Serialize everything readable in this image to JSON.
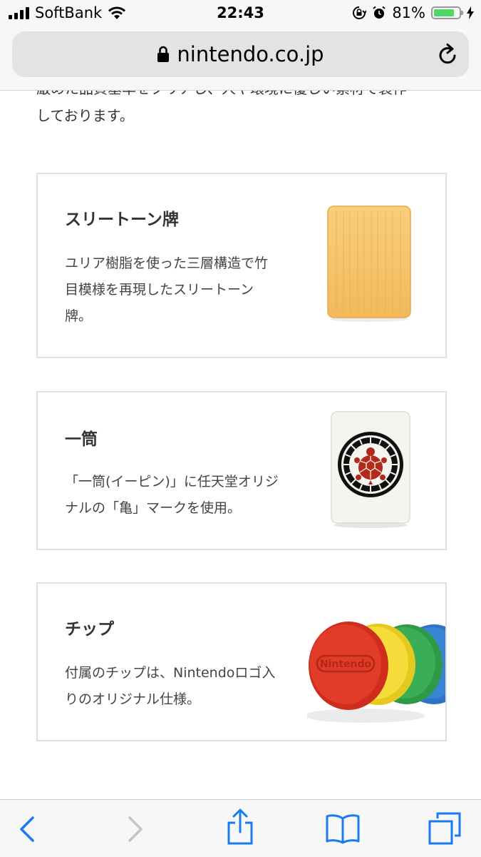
{
  "status_bar": {
    "carrier": "SoftBank",
    "time": "22:43",
    "battery_percent": "81%",
    "battery_level": 0.81,
    "icons": [
      "signal-icon",
      "wifi-icon",
      "rotation-lock-icon",
      "alarm-icon",
      "battery-icon",
      "charging-icon"
    ]
  },
  "url_bar": {
    "domain": "nintendo.co.jp",
    "icons": [
      "lock-icon",
      "reload-icon"
    ]
  },
  "intro_text": {
    "line1": "厳めた品質基準をクリアし、人や環境に優しい素材で製作",
    "line2": "しております。"
  },
  "features": [
    {
      "title": "スリートーン牌",
      "lines": [
        "ユリア樹脂を使った三層構造で竹",
        "目模様を再現したスリートーン",
        "牌。"
      ],
      "image": "three-tone-tile"
    },
    {
      "title": "一筒",
      "lines": [
        "「一筒(イーピン)」に任天堂オリジ",
        "ナルの「亀」マークを使用。"
      ],
      "image": "ipin-turtle-tile"
    },
    {
      "title": "チップ",
      "lines": [
        "付属のチップは、Nintendoロゴ入",
        "りのオリジナル仕様。"
      ],
      "image": "nintendo-chips",
      "chip_logo_text": "Nintendo"
    }
  ],
  "toolbar": {
    "icons": [
      "back-icon",
      "forward-icon",
      "share-icon",
      "bookmarks-icon",
      "tabs-icon"
    ]
  }
}
